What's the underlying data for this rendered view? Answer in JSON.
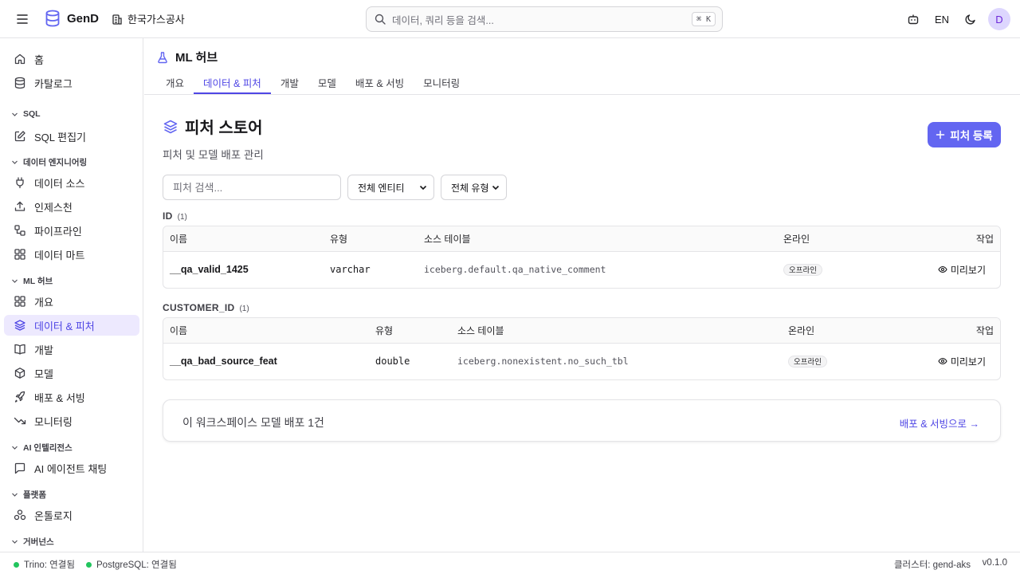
{
  "topbar": {
    "brand": "GenD",
    "org": "한국가스공사",
    "search_placeholder": "데이터, 쿼리 등을 검색...",
    "shortcut": "⌘ K",
    "lang": "EN",
    "avatar_initial": "D"
  },
  "sidebar": {
    "home": "홈",
    "catalog": "카탈로그",
    "sec_sql": "SQL",
    "sql_editor": "SQL 편집기",
    "sec_de": "데이터 엔지니어링",
    "data_source": "데이터 소스",
    "ingestion": "인제스천",
    "pipeline": "파이프라인",
    "data_mart": "데이터 마트",
    "sec_ml": "ML 허브",
    "ml_overview": "개요",
    "ml_data_feature": "데이터 & 피처",
    "ml_dev": "개발",
    "ml_model": "모델",
    "ml_deploy": "배포 & 서빙",
    "ml_monitor": "모니터링",
    "sec_ai": "AI 인텔리전스",
    "ai_chat": "AI 에이전트 채팅",
    "sec_platform": "플랫폼",
    "ontology": "온톨로지",
    "sec_gov": "거버넌스"
  },
  "hub": {
    "title": "ML 허브",
    "tabs": [
      "개요",
      "데이터 & 피처",
      "개발",
      "모델",
      "배포 & 서빙",
      "모니터링"
    ]
  },
  "page": {
    "title": "피처 스토어",
    "subtitle": "피처 및 모델 배포 관리",
    "register_button": "피처 등록"
  },
  "filters": {
    "search_placeholder": "피처 검색...",
    "entity_select": "전체 엔티티",
    "type_select": "전체 유형"
  },
  "columns": {
    "name": "이름",
    "type": "유형",
    "source": "소스 테이블",
    "online": "온라인",
    "action": "작업"
  },
  "groups": [
    {
      "label": "ID",
      "count": "(1)",
      "rows": [
        {
          "name": "__qa_valid_1425",
          "type": "varchar",
          "source": "iceberg.default.qa_native_comment",
          "online": "오프라인",
          "action": "미리보기"
        }
      ]
    },
    {
      "label": "CUSTOMER_ID",
      "count": "(1)",
      "rows": [
        {
          "name": "__qa_bad_source_feat",
          "type": "double",
          "source": "iceberg.nonexistent.no_such_tbl",
          "online": "오프라인",
          "action": "미리보기"
        }
      ]
    }
  ],
  "deploy": {
    "text": "이 워크스페이스 모델 배포 1건",
    "link": "배포 & 서빙으로 →"
  },
  "status": {
    "trino": "Trino: 연결됨",
    "postgres": "PostgreSQL: 연결됨",
    "cluster": "클러스터: gend-aks",
    "version": "v0.1.0"
  },
  "colors": {
    "accent": "#6366f1",
    "active_bg": "#ede9fe",
    "connected": "#22c55e"
  }
}
